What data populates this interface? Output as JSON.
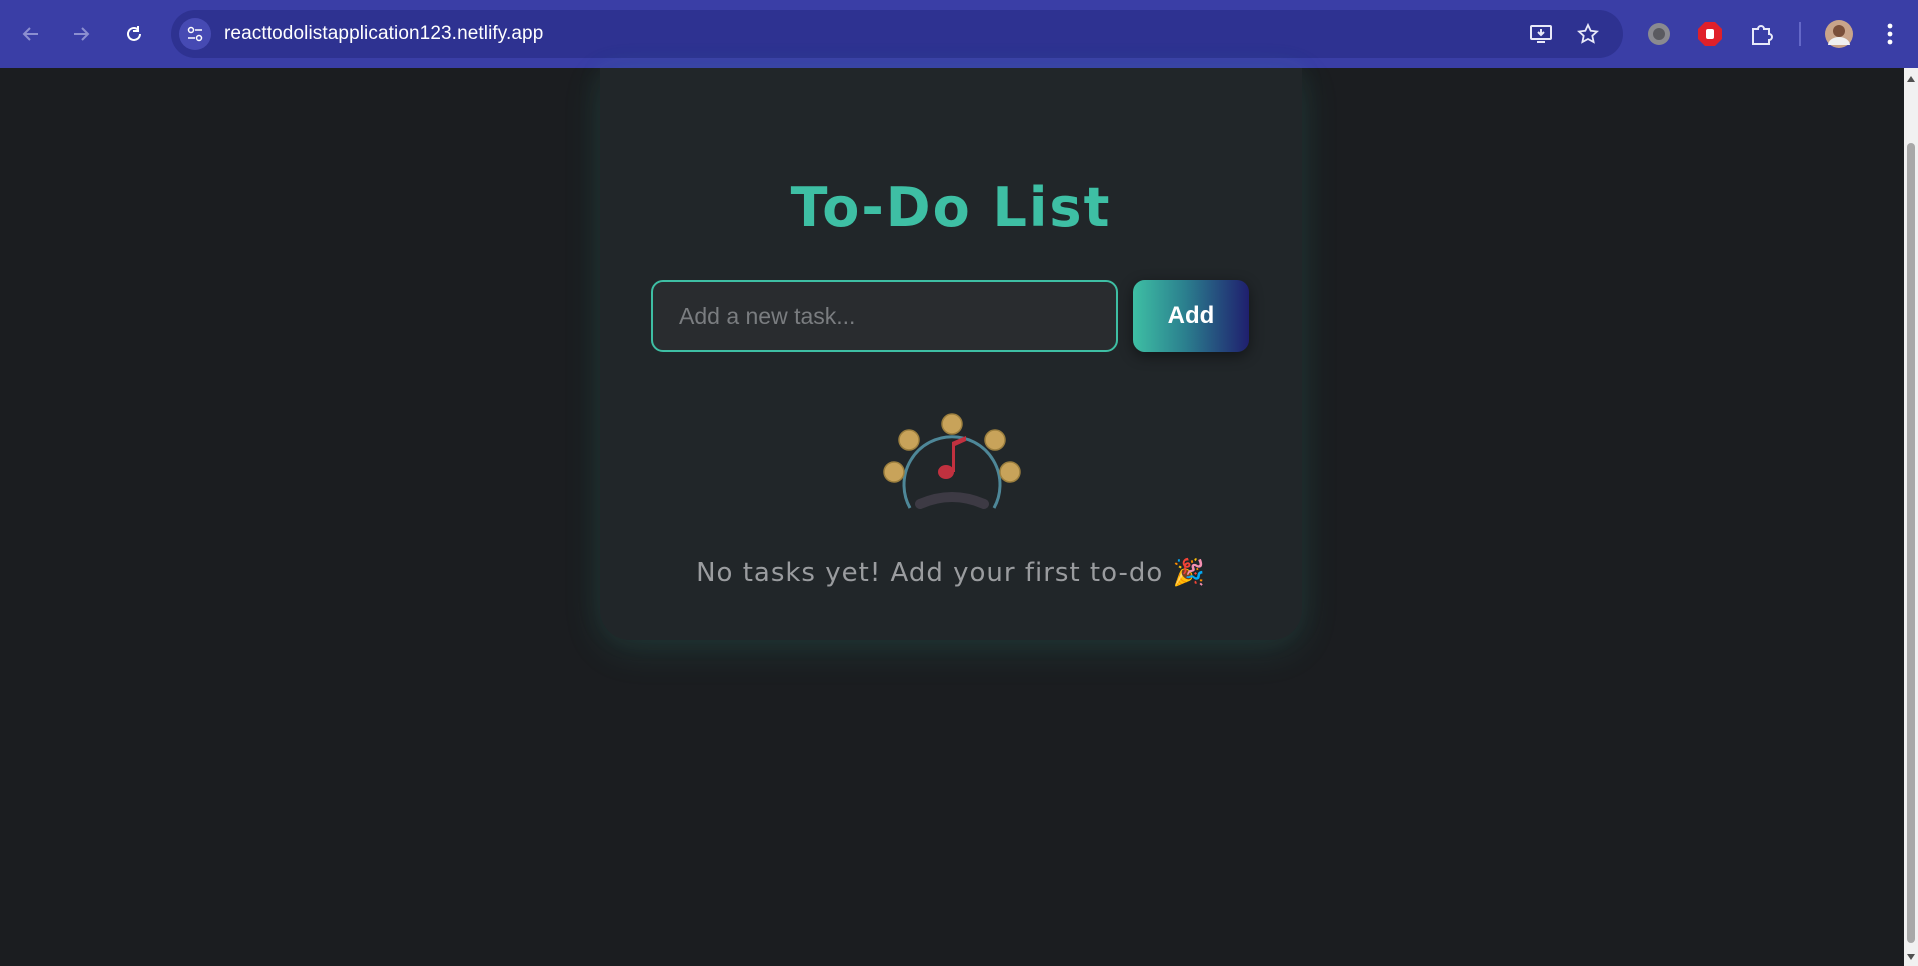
{
  "browser": {
    "url": "reacttodolistapplication123.netlify.app",
    "icons": [
      "back-icon",
      "forward-icon",
      "reload-icon",
      "site-info-icon",
      "install-app-icon",
      "bookmark-star-icon",
      "extension-circle-icon",
      "adblock-hand-icon",
      "extensions-puzzle-icon",
      "profile-avatar",
      "menu-dots-icon"
    ],
    "accent": "#3a3ea6"
  },
  "app": {
    "title": "To-Do List",
    "input": {
      "placeholder": "Add a new task...",
      "value": ""
    },
    "add_button": "Add",
    "empty_state": {
      "message": "No tasks yet! Add your first to-do 🎉",
      "illustration": "tambourine-music-note"
    },
    "colors": {
      "accent": "#3ebfa4",
      "background": "#1b1d20",
      "card": "#212629"
    }
  }
}
